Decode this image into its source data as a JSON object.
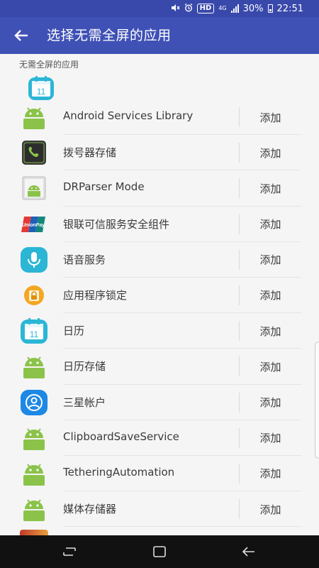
{
  "status_bar": {
    "hd_label": "HD",
    "network": "4G",
    "battery": "30%",
    "time": "22:51"
  },
  "appbar": {
    "title": "选择无需全屏的应用"
  },
  "section_header": "无需全屏的应用",
  "add_label": "添加",
  "apps": [
    {
      "name": "Android Services Library",
      "icon": "android-icon"
    },
    {
      "name": "拨号器存储",
      "icon": "phone-icon"
    },
    {
      "name": "DRParser Mode",
      "icon": "android-generic-icon"
    },
    {
      "name": "银联可信服务安全组件",
      "icon": "unionpay-icon"
    },
    {
      "name": "语音服务",
      "icon": "microphone-icon"
    },
    {
      "name": "应用程序锁定",
      "icon": "lock-app-icon"
    },
    {
      "name": "日历",
      "icon": "calendar-icon"
    },
    {
      "name": "日历存储",
      "icon": "android-icon"
    },
    {
      "name": "三星帐户",
      "icon": "samsung-account-icon"
    },
    {
      "name": "ClipboardSaveService",
      "icon": "android-icon"
    },
    {
      "name": "TetheringAutomation",
      "icon": "android-icon"
    },
    {
      "name": "媒体存储器",
      "icon": "android-icon"
    }
  ],
  "colors": {
    "appbar": "#3f51b5",
    "statusbar": "#3949ab",
    "android_green": "#8bc34a",
    "calendar_teal": "#2bb6d6",
    "samsung_blue": "#1e88e5"
  }
}
